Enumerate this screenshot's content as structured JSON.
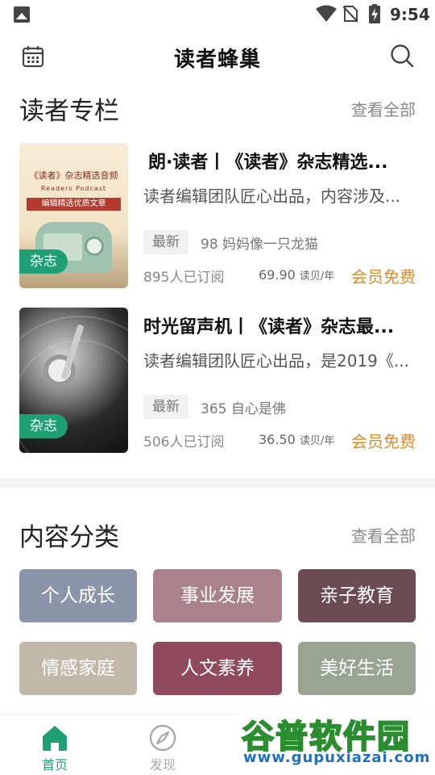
{
  "status_bar": {
    "time": "9:54",
    "icons": [
      "gallery-icon",
      "wifi-icon",
      "no-sim-icon",
      "battery-charging-icon"
    ]
  },
  "header": {
    "title": "读者蜂巢",
    "left_icon": "calendar-icon",
    "right_icon": "search-icon"
  },
  "columns_section": {
    "title": "读者专栏",
    "more": "查看全部",
    "items": [
      {
        "cover_texts": [
          "《读者》杂志精选音频",
          "Readers Podcast",
          "编辑精选优质文章"
        ],
        "tag": "杂志",
        "title": "朗·读者丨《读者》杂志精选...",
        "desc": "读者编辑团队匠心出品，内容涉及...",
        "latest_label": "最新",
        "latest_episode": "98  妈妈像一只龙猫",
        "subscribers": "895人已订阅",
        "price": "69.90",
        "price_unit": "读贝/年",
        "member": "会员免费"
      },
      {
        "cover_texts": [],
        "tag": "杂志",
        "title": "时光留声机丨《读者》杂志最...",
        "desc": "读者编辑团队匠心出品，是2019《...",
        "latest_label": "最新",
        "latest_episode": "365  自心是佛",
        "subscribers": "506人已订阅",
        "price": "36.50",
        "price_unit": "读贝/年",
        "member": "会员免费"
      }
    ]
  },
  "categories_section": {
    "title": "内容分类",
    "more": "查看全部",
    "items": [
      {
        "label": "个人成长",
        "color": "#8b95aa"
      },
      {
        "label": "事业发展",
        "color": "#a9828b"
      },
      {
        "label": "亲子教育",
        "color": "#6b4c55"
      },
      {
        "label": "情感家庭",
        "color": "#c2b8a9"
      },
      {
        "label": "人文素养",
        "color": "#8f4a5d"
      },
      {
        "label": "美好生活",
        "color": "#9ba392"
      }
    ]
  },
  "bottom_nav": {
    "items": [
      {
        "label": "首页",
        "icon": "home-icon",
        "active": true
      },
      {
        "label": "发现",
        "icon": "compass-icon",
        "active": false
      }
    ],
    "active_color": "#1e9f74",
    "inactive_color": "#aaaaaa"
  },
  "watermark": {
    "line1": "谷普软件园",
    "line2": "www.gupuxiazai.com"
  }
}
